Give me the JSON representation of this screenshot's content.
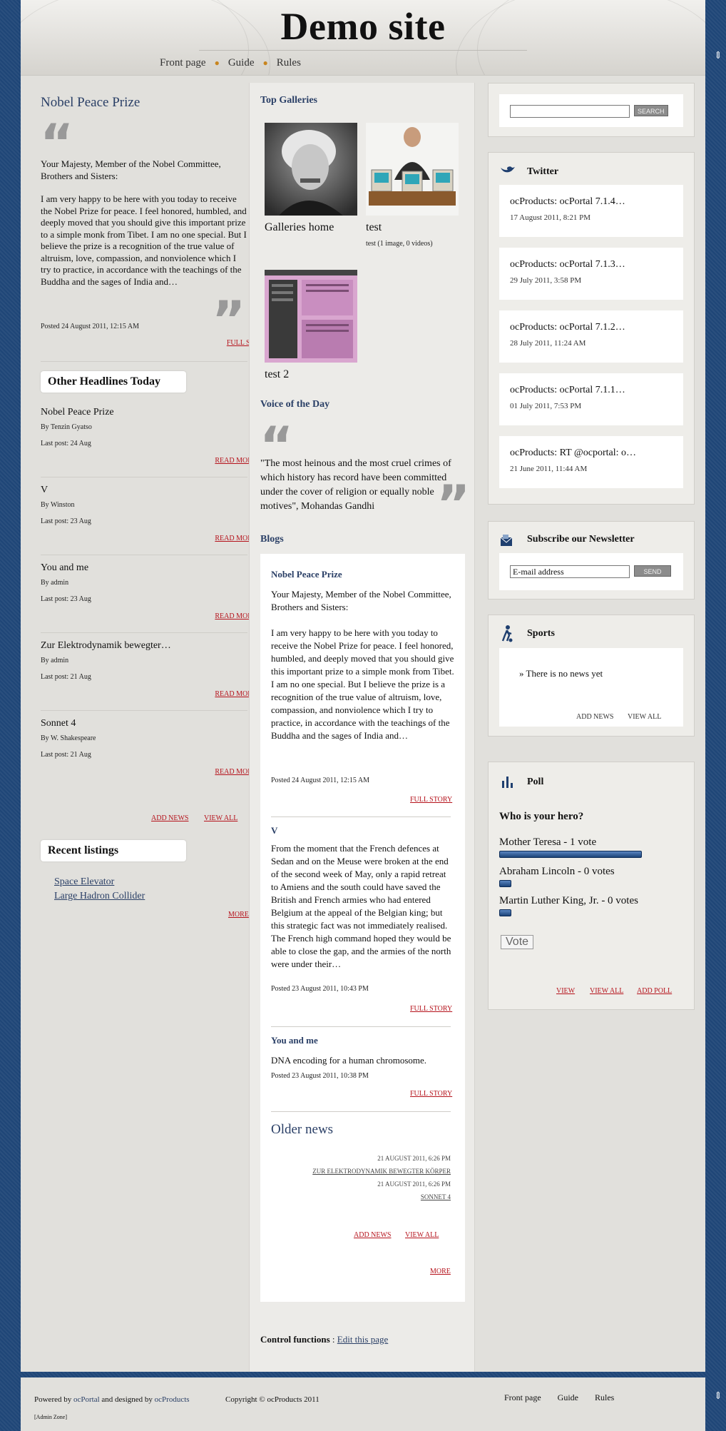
{
  "header": {
    "title": "Demo site",
    "nav": [
      "Front page",
      "Guide",
      "Rules"
    ]
  },
  "left": {
    "news": {
      "title": "Nobel Peace Prize",
      "p1": "Your Majesty, Member of the Nobel Committee, Brothers and Sisters:",
      "p2": "I am very happy to be here with you today to receive the Nobel Prize for peace. I feel honored, humbled, and deeply moved that you should give this important prize to a simple monk from Tibet. I am no one special. But I believe the prize is a recognition of the true value of altruism, love, compassion, and nonviolence which I try to practice, in accordance with the teachings of the Buddha and the sages of India and…",
      "posted": "Posted 24 August 2011, 12:15 AM",
      "link": "FULL STORY"
    },
    "headlines": {
      "title": "Other Headlines Today",
      "items": [
        {
          "title": "Nobel Peace Prize",
          "by": "By Tenzin Gyatso",
          "last": "Last post: 24 Aug",
          "link": "READ MORE"
        },
        {
          "title": "V",
          "by": "By Winston",
          "last": "Last post: 23 Aug",
          "link": "READ MORE"
        },
        {
          "title": "You and me",
          "by": "By admin",
          "last": "Last post: 23 Aug",
          "link": "READ MORE"
        },
        {
          "title": "Zur Elektrodynamik bewegter…",
          "by": "By admin",
          "last": "Last post: 21 Aug",
          "link": "READ MORE"
        },
        {
          "title": "Sonnet 4",
          "by": "By W. Shakespeare",
          "last": "Last post: 21 Aug",
          "link": "READ MORE"
        }
      ],
      "add": "ADD NEWS",
      "view": "VIEW ALL"
    },
    "listings": {
      "title": "Recent listings",
      "items": [
        "Space Elevator",
        "Large Hadron Collider"
      ],
      "more": "MORE"
    }
  },
  "center": {
    "galleries": {
      "title": "Top Galleries",
      "items": [
        {
          "label": "Galleries home",
          "sub": ""
        },
        {
          "label": "test",
          "sub": "test (1 image, 0 videos)"
        },
        {
          "label": "test 2",
          "sub": ""
        }
      ]
    },
    "voice": {
      "title": "Voice of the Day",
      "text": "\"The most heinous and the most cruel crimes of which history has record have been committed under the cover of religion or equally noble motives\", Mohandas Gandhi"
    },
    "blogs": {
      "title": "Blogs",
      "entries": [
        {
          "title": "Nobel Peace Prize",
          "p1": "Your Majesty, Member of the Nobel Committee, Brothers and Sisters:",
          "p2": "I am very happy to be here with you today to receive the Nobel Prize for peace. I feel honored, humbled, and deeply moved that you should give this important prize to a simple monk from Tibet. I am no one special. But I believe the prize is a recognition of the true value of altruism, love, compassion, and nonviolence which I try to practice, in accordance with the teachings of the Buddha and the sages of India and…",
          "posted": "Posted 24 August 2011, 12:15 AM",
          "link": "FULL STORY"
        },
        {
          "title": "V",
          "p1": "From the moment that the French defences at Sedan and on the Meuse were broken at the end of the second week of May, only a rapid retreat to Amiens and the south could have saved the British and French armies who had entered Belgium at the appeal of the Belgian king; but this strategic fact was not immediately realised. The French high command hoped they would be able to close the gap, and the armies of the north were under their…",
          "posted": "Posted 23 August 2011, 10:43 PM",
          "link": "FULL STORY"
        },
        {
          "title": "You and me",
          "p1": "DNA encoding for a human chromosome.",
          "posted": "Posted 23 August 2011, 10:38 PM",
          "link": "FULL STORY"
        }
      ],
      "older": {
        "title": "Older news",
        "d1": "21 AUGUST 2011, 6:26 PM",
        "l1": "ZUR ELEKTRODYNAMIK BEWEGTER KÖRPER",
        "d2": "21 AUGUST 2011, 6:26 PM",
        "l2": "SONNET 4"
      },
      "add": "ADD NEWS",
      "view": "VIEW ALL",
      "more": "MORE"
    },
    "control": {
      "label": "Control functions",
      "sep": " : ",
      "link": "Edit this page"
    }
  },
  "right": {
    "search": {
      "placeholder": "",
      "button": "SEARCH"
    },
    "twitter": {
      "title": "Twitter",
      "tweets": [
        {
          "text": "ocProducts: ocPortal 7.1.4…",
          "date": "17 August 2011, 8:21 PM"
        },
        {
          "text": "ocProducts: ocPortal 7.1.3…",
          "date": "29 July 2011, 3:58 PM"
        },
        {
          "text": "ocProducts: ocPortal 7.1.2…",
          "date": "28 July 2011, 11:24 AM"
        },
        {
          "text": "ocProducts: ocPortal 7.1.1…",
          "date": "01 July 2011, 7:53 PM"
        },
        {
          "text": "ocProducts: RT @ocportal: o…",
          "date": "21 June 2011, 11:44 AM"
        }
      ]
    },
    "newsletter": {
      "title": "Subscribe our Newsletter",
      "value": "E-mail address",
      "button": "SEND"
    },
    "sports": {
      "title": "Sports",
      "empty": "» There is no news yet",
      "add": "ADD NEWS",
      "view": "VIEW ALL"
    },
    "poll": {
      "title": "Poll",
      "question": "Who is your hero?",
      "options": [
        {
          "label": "Mother Teresa - 1 vote",
          "share": 1.0
        },
        {
          "label": "Abraham Lincoln - 0 votes",
          "share": 0.0
        },
        {
          "label": "Martin Luther King, Jr. - 0 votes",
          "share": 0.0
        }
      ],
      "vote": "Vote",
      "view": "VIEW",
      "view_all": "VIEW ALL",
      "add": "ADD POLL"
    }
  },
  "footer": {
    "powered": "Powered by ",
    "ocportal": "ocPortal",
    "and": " and designed by ",
    "ocproducts": "ocProducts",
    "copyright": "Copyright © ocProducts 2011",
    "admin": "[Admin Zone]",
    "nav": [
      "Front page",
      "Guide",
      "Rules"
    ]
  }
}
